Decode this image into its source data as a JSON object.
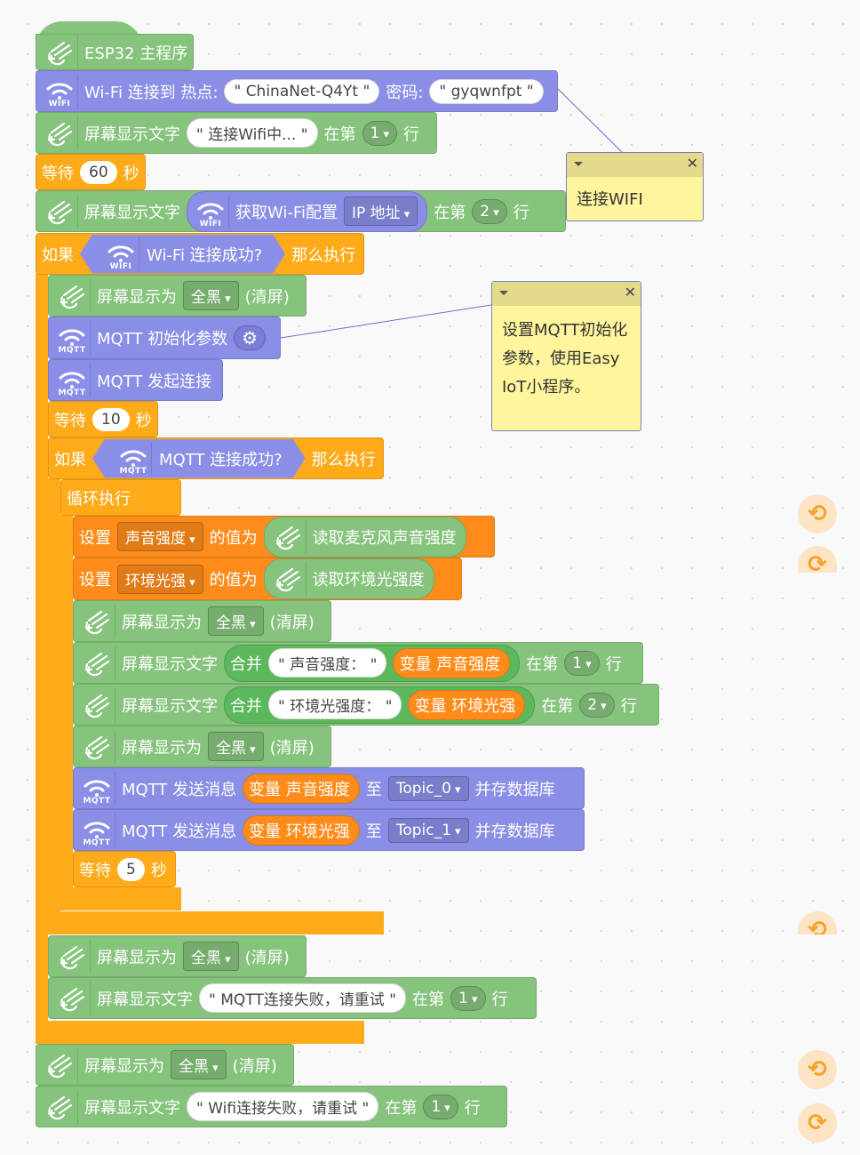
{
  "colors": {
    "green": "#86c37d",
    "purple": "#8a8ee6",
    "orange": "#ffab19",
    "setorange": "#ff8c1a",
    "bright": "#5cb85c",
    "note": "#fff59d"
  },
  "blocks": [
    {
      "c": "green",
      "items": [
        {
          "t": "icon",
          "v": "mixly"
        },
        {
          "t": "text",
          "v": "ESP32 主程序"
        }
      ]
    },
    {
      "c": "purple",
      "items": [
        {
          "t": "icon",
          "v": "wifi",
          "sub": "WIFI"
        },
        {
          "t": "text",
          "v": "Wi-Fi 连接到 热点:"
        },
        {
          "t": "str",
          "v": "ChinaNet-Q4Yt"
        },
        {
          "t": "text",
          "v": "密码:"
        },
        {
          "t": "str",
          "v": "gyqwnfpt"
        }
      ]
    },
    {
      "c": "green",
      "items": [
        {
          "t": "icon",
          "v": "mixly"
        },
        {
          "t": "text",
          "v": "屏幕显示文字"
        },
        {
          "t": "str",
          "v": "连接Wifi中..."
        },
        {
          "t": "text",
          "v": "在第"
        },
        {
          "t": "dd",
          "v": "1"
        },
        {
          "t": "text",
          "v": "行"
        }
      ]
    },
    {
      "c": "orange",
      "items": [
        {
          "t": "text",
          "v": "等待"
        },
        {
          "t": "num",
          "v": "60"
        },
        {
          "t": "text",
          "v": "秒"
        }
      ]
    },
    {
      "c": "green",
      "items": [
        {
          "t": "icon",
          "v": "mixly"
        },
        {
          "t": "text",
          "v": "屏幕显示文字"
        },
        {
          "t": "rep",
          "c": "purple",
          "items": [
            {
              "t": "icon",
              "v": "wifi",
              "sub": "WIFI"
            },
            {
              "t": "text",
              "v": "获取Wi-Fi配置"
            },
            {
              "t": "dd",
              "sq": true,
              "v": "IP 地址"
            }
          ]
        },
        {
          "t": "text",
          "v": "在第"
        },
        {
          "t": "dd",
          "v": "2"
        },
        {
          "t": "text",
          "v": "行"
        }
      ]
    },
    {
      "c": "orange",
      "items": [
        {
          "t": "text",
          "v": "如果"
        },
        {
          "t": "hex",
          "c": "purple",
          "items": [
            {
              "t": "icon",
              "v": "wifi",
              "sub": "WIFI"
            },
            {
              "t": "text",
              "v": "Wi-Fi 连接成功?"
            }
          ]
        },
        {
          "t": "text",
          "v": "那么执行"
        }
      ]
    },
    {
      "c": "green",
      "items": [
        {
          "t": "icon",
          "v": "mixly"
        },
        {
          "t": "text",
          "v": "屏幕显示为"
        },
        {
          "t": "dd",
          "sq": true,
          "v": "全黑"
        },
        {
          "t": "text",
          "v": "(清屏)"
        }
      ]
    },
    {
      "c": "purple",
      "items": [
        {
          "t": "icon",
          "v": "wifi",
          "sub": "MQTT"
        },
        {
          "t": "text",
          "v": "MQTT 初始化参数"
        },
        {
          "t": "gear",
          "v": "gear"
        }
      ]
    },
    {
      "c": "purple",
      "items": [
        {
          "t": "icon",
          "v": "wifi",
          "sub": "MQTT"
        },
        {
          "t": "text",
          "v": "MQTT 发起连接"
        }
      ]
    },
    {
      "c": "orange",
      "items": [
        {
          "t": "text",
          "v": "等待"
        },
        {
          "t": "num",
          "v": "10"
        },
        {
          "t": "text",
          "v": "秒"
        }
      ]
    },
    {
      "c": "orange",
      "items": [
        {
          "t": "text",
          "v": "如果"
        },
        {
          "t": "hex",
          "c": "purple",
          "items": [
            {
              "t": "icon",
              "v": "wifi",
              "sub": "MQTT"
            },
            {
              "t": "text",
              "v": "MQTT 连接成功?"
            }
          ]
        },
        {
          "t": "text",
          "v": "那么执行"
        }
      ]
    },
    {
      "c": "orange",
      "items": [
        {
          "t": "text",
          "v": "循环执行"
        }
      ]
    },
    {
      "c": "setorange",
      "items": [
        {
          "t": "text",
          "v": "设置"
        },
        {
          "t": "dd",
          "sq": true,
          "v": "声音强度"
        },
        {
          "t": "text",
          "v": "的值为"
        },
        {
          "t": "rep",
          "c": "green",
          "items": [
            {
              "t": "icon",
              "v": "mixly"
            },
            {
              "t": "text",
              "v": "读取麦克风声音强度"
            }
          ]
        }
      ]
    },
    {
      "c": "setorange",
      "items": [
        {
          "t": "text",
          "v": "设置"
        },
        {
          "t": "dd",
          "sq": true,
          "v": "环境光强"
        },
        {
          "t": "text",
          "v": "的值为"
        },
        {
          "t": "rep",
          "c": "green",
          "items": [
            {
              "t": "icon",
              "v": "mixly"
            },
            {
              "t": "text",
              "v": "读取环境光强度"
            }
          ]
        }
      ]
    },
    {
      "c": "green",
      "items": [
        {
          "t": "icon",
          "v": "mixly"
        },
        {
          "t": "text",
          "v": "屏幕显示为"
        },
        {
          "t": "dd",
          "sq": true,
          "v": "全黑"
        },
        {
          "t": "text",
          "v": "(清屏)"
        }
      ]
    },
    {
      "c": "green",
      "items": [
        {
          "t": "icon",
          "v": "mixly"
        },
        {
          "t": "text",
          "v": "屏幕显示文字"
        },
        {
          "t": "rep",
          "c": "bright",
          "items": [
            {
              "t": "text",
              "v": "合并"
            },
            {
              "t": "str",
              "v": "声音强度： "
            },
            {
              "t": "rep",
              "c": "setorange",
              "items": [
                {
                  "t": "text",
                  "v": "变量 声音强度"
                }
              ]
            }
          ]
        },
        {
          "t": "text",
          "v": "在第"
        },
        {
          "t": "dd",
          "v": "1"
        },
        {
          "t": "text",
          "v": "行"
        }
      ]
    },
    {
      "c": "green",
      "items": [
        {
          "t": "icon",
          "v": "mixly"
        },
        {
          "t": "text",
          "v": "屏幕显示文字"
        },
        {
          "t": "rep",
          "c": "bright",
          "items": [
            {
              "t": "text",
              "v": "合并"
            },
            {
              "t": "str",
              "v": "环境光强度： "
            },
            {
              "t": "rep",
              "c": "setorange",
              "items": [
                {
                  "t": "text",
                  "v": "变量 环境光强"
                }
              ]
            }
          ]
        },
        {
          "t": "text",
          "v": "在第"
        },
        {
          "t": "dd",
          "v": "2"
        },
        {
          "t": "text",
          "v": "行"
        }
      ]
    },
    {
      "c": "green",
      "items": [
        {
          "t": "icon",
          "v": "mixly"
        },
        {
          "t": "text",
          "v": "屏幕显示为"
        },
        {
          "t": "dd",
          "sq": true,
          "v": "全黑"
        },
        {
          "t": "text",
          "v": "(清屏)"
        }
      ]
    },
    {
      "c": "purple",
      "items": [
        {
          "t": "icon",
          "v": "wifi",
          "sub": "MQTT"
        },
        {
          "t": "text",
          "v": "MQTT 发送消息"
        },
        {
          "t": "rep",
          "c": "setorange",
          "items": [
            {
              "t": "text",
              "v": "变量 声音强度"
            }
          ]
        },
        {
          "t": "text",
          "v": "至"
        },
        {
          "t": "dd",
          "sq": true,
          "v": "Topic_0"
        },
        {
          "t": "text",
          "v": "并存数据库"
        }
      ]
    },
    {
      "c": "purple",
      "items": [
        {
          "t": "icon",
          "v": "wifi",
          "sub": "MQTT"
        },
        {
          "t": "text",
          "v": "MQTT 发送消息"
        },
        {
          "t": "rep",
          "c": "setorange",
          "items": [
            {
              "t": "text",
              "v": "变量 环境光强"
            }
          ]
        },
        {
          "t": "text",
          "v": "至"
        },
        {
          "t": "dd",
          "sq": true,
          "v": "Topic_1"
        },
        {
          "t": "text",
          "v": "并存数据库"
        }
      ]
    },
    {
      "c": "orange",
      "items": [
        {
          "t": "text",
          "v": "等待"
        },
        {
          "t": "num",
          "v": "5"
        },
        {
          "t": "text",
          "v": "秒"
        }
      ]
    },
    {
      "c": "green",
      "items": [
        {
          "t": "icon",
          "v": "mixly"
        },
        {
          "t": "text",
          "v": "屏幕显示为"
        },
        {
          "t": "dd",
          "sq": true,
          "v": "全黑"
        },
        {
          "t": "text",
          "v": "(清屏)"
        }
      ]
    },
    {
      "c": "green",
      "items": [
        {
          "t": "icon",
          "v": "mixly"
        },
        {
          "t": "text",
          "v": "屏幕显示文字"
        },
        {
          "t": "str",
          "v": "MQTT连接失败，请重试"
        },
        {
          "t": "text",
          "v": "在第"
        },
        {
          "t": "dd",
          "v": "1"
        },
        {
          "t": "text",
          "v": "行"
        }
      ]
    },
    {
      "c": "green",
      "items": [
        {
          "t": "icon",
          "v": "mixly"
        },
        {
          "t": "text",
          "v": "屏幕显示为"
        },
        {
          "t": "dd",
          "sq": true,
          "v": "全黑"
        },
        {
          "t": "text",
          "v": "(清屏)"
        }
      ]
    },
    {
      "c": "green",
      "items": [
        {
          "t": "icon",
          "v": "mixly"
        },
        {
          "t": "text",
          "v": "屏幕显示文字"
        },
        {
          "t": "str",
          "v": "Wifi连接失败，请重试"
        },
        {
          "t": "text",
          "v": "在第"
        },
        {
          "t": "dd",
          "v": "1"
        },
        {
          "t": "text",
          "v": "行"
        }
      ]
    }
  ],
  "comments": [
    {
      "text": "连接WIFI"
    },
    {
      "text": "设置MQTT初始化\n参数，使用Easy\nIoT小程序。"
    }
  ],
  "controls": [
    {
      "icon": "undo-icon",
      "glyph": "⟲"
    },
    {
      "icon": "redo-icon",
      "glyph": "⟳"
    },
    {
      "icon": "undo-icon",
      "glyph": "⟲"
    },
    {
      "icon": "undo-icon",
      "glyph": "⟲"
    },
    {
      "icon": "redo-icon",
      "glyph": "⟳"
    }
  ]
}
